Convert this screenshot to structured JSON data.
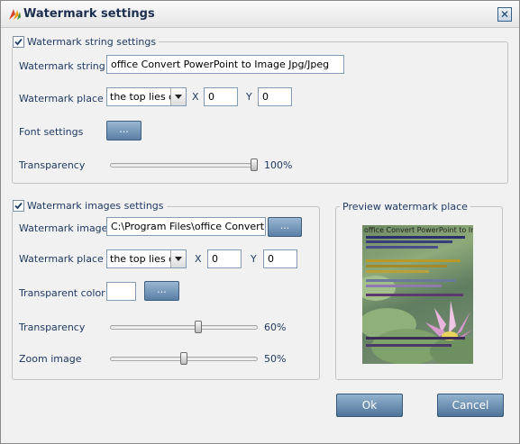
{
  "window": {
    "title": "Watermark settings",
    "close_glyph": "✕"
  },
  "string_group": {
    "legend": "Watermark string settings",
    "checked": true,
    "string_label": "Watermark string",
    "string_value": "office Convert PowerPoint to Image Jpg/Jpeg",
    "place_label": "Watermark place",
    "place_value": "the top lies on",
    "x_label": "X",
    "x_value": "0",
    "y_label": "Y",
    "y_value": "0",
    "font_label": "Font settings",
    "font_button": "...",
    "transparency_label": "Transparency",
    "transparency_value": "100%",
    "transparency_fraction": 1.0
  },
  "image_group": {
    "legend": "Watermark images settings",
    "checked": true,
    "image_label": "Watermark image",
    "image_value": "C:\\Program Files\\office Convert Po",
    "browse_button": "...",
    "place_label": "Watermark place",
    "place_value": "the top lies on",
    "x_label": "X",
    "x_value": "0",
    "y_label": "Y",
    "y_value": "0",
    "color_label": "Transparent color",
    "color_value": "#ffffff",
    "color_button": "...",
    "transparency_label": "Transparency",
    "transparency_value": "60%",
    "transparency_fraction": 0.6,
    "zoom_label": "Zoom image",
    "zoom_value": "50%",
    "zoom_fraction": 0.5
  },
  "preview_group": {
    "legend": "Preview watermark place",
    "preview_text": "office Convert PowerPoint to Image"
  },
  "buttons": {
    "ok": "Ok",
    "cancel": "Cancel"
  },
  "colors": {
    "accent": "#5a7fa6",
    "text": "#1f3a63"
  },
  "icons": {
    "title": "watermark-app-icon",
    "close": "close-icon",
    "check": "checkmark-icon",
    "dropdown": "chevron-down-icon"
  }
}
